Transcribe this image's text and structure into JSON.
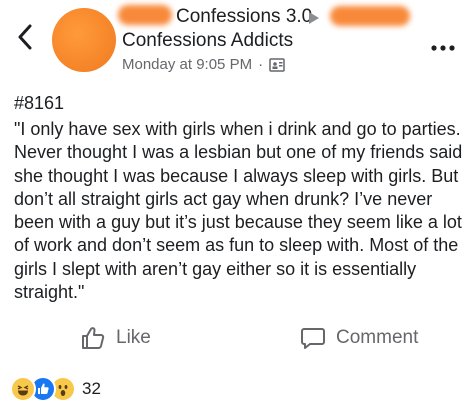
{
  "header": {
    "group_name": "Confessions 3.0",
    "page_name": "Confessions Addicts",
    "timestamp": "Monday at 9:05 PM",
    "separator": "·"
  },
  "post": {
    "id": "#8161",
    "text": "\"I only have sex with girls when i drink and go to parties. Never thought I was a lesbian but one of my friends said she thought I was because I always sleep with girls. But don’t all straight girls act gay when drunk? I’ve never been with a guy but it’s just because they seem like a lot of work and don’t seem as fun to sleep with. Most of the girls I slept with aren’t gay either so it is essentially straight.\""
  },
  "actions": {
    "like_label": "Like",
    "comment_label": "Comment"
  },
  "reactions": {
    "icons": [
      "haha-icon",
      "like-icon",
      "wow-icon"
    ],
    "count": "32"
  },
  "colors": {
    "redaction": "#f8893a",
    "secondary_text": "#65676b",
    "like_blue": "#1877f2",
    "emoji_yellow": "#f7c84a"
  }
}
